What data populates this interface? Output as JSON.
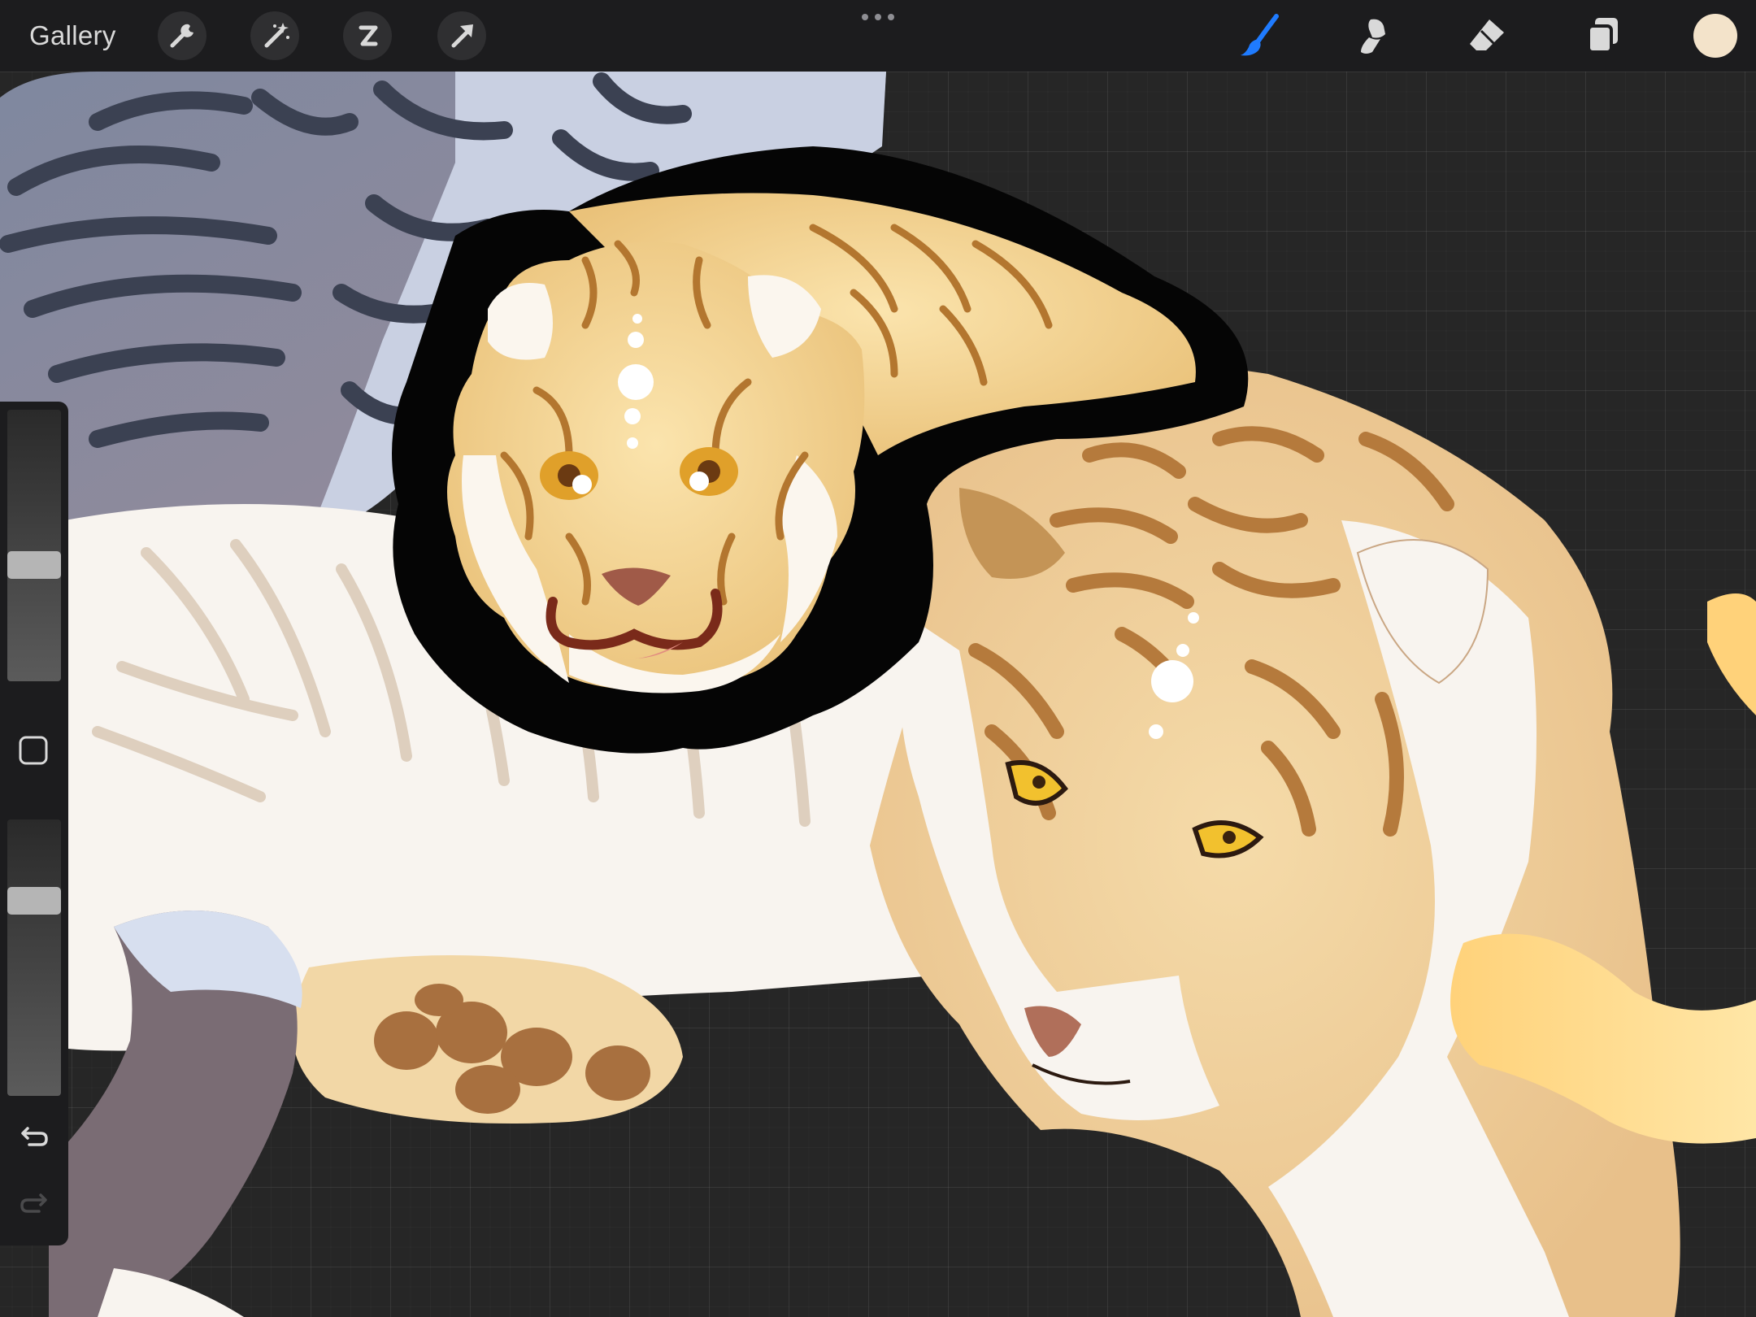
{
  "topbar": {
    "gallery_label": "Gallery",
    "left_tools": [
      "wrench-icon",
      "magic-wand-icon",
      "selection-icon",
      "transform-arrow-icon"
    ],
    "more_menu_icon": "three-dots-icon",
    "right_tools": [
      "brush-icon",
      "smudge-icon",
      "eraser-icon",
      "layers-icon"
    ],
    "active_tool": "brush",
    "active_color": "#f3e3ca",
    "accent_color": "#1f7bff"
  },
  "sidebar": {
    "controls": [
      "brush-size-slider",
      "modify-button",
      "opacity-slider",
      "undo-icon",
      "redo-icon"
    ],
    "brush_size_level": 0.58,
    "opacity_level": 0.27,
    "redo_enabled": false
  },
  "canvas": {
    "grid_visible": true,
    "background_color": "#262626"
  }
}
